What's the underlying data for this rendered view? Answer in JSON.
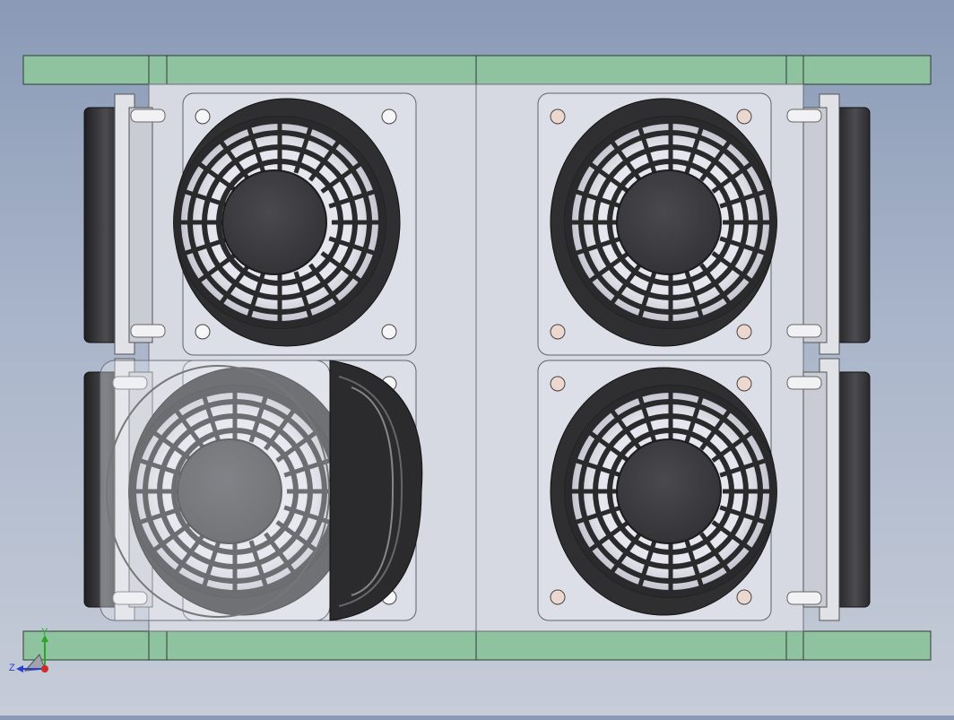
{
  "viewport": {
    "description_free": true,
    "colors": {
      "background_top": "#8a9ab6",
      "background_bottom": "#c6ccd8",
      "rail": "#8fc3a0",
      "panel": "#d4d7df",
      "fan_dark": "#3c3c3f",
      "grille": "#2a2a2d"
    }
  },
  "fans": [
    {
      "id": "fan-top-left"
    },
    {
      "id": "fan-top-right"
    },
    {
      "id": "fan-bottom-left"
    },
    {
      "id": "fan-bottom-right"
    }
  ],
  "triad": {
    "x_label": "",
    "y_label": "Y",
    "z_label": "Z",
    "colors": {
      "x": "#d12a2a",
      "y": "#2aa52a",
      "z": "#2a3fd1"
    }
  }
}
